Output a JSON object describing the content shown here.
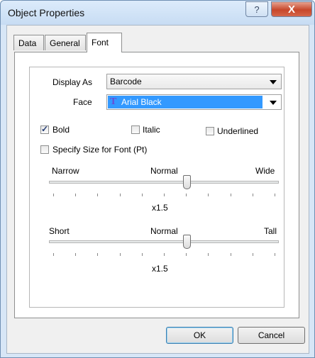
{
  "window": {
    "title": "Object Properties",
    "help_glyph": "?",
    "close_glyph": "X"
  },
  "tabs": [
    {
      "label": "Data"
    },
    {
      "label": "General"
    },
    {
      "label": "Font"
    }
  ],
  "form": {
    "display_as_label": "Display As",
    "display_as_value": "Barcode",
    "face_label": "Face",
    "face_value": "Arial Black",
    "face_icon_glyph": "T",
    "bold_label": "Bold",
    "bold_checked": true,
    "italic_label": "Italic",
    "italic_checked": false,
    "underlined_label": "Underlined",
    "underlined_checked": false,
    "specify_size_label": "Specify Size for Font (Pt)",
    "specify_size_checked": false
  },
  "width_slider": {
    "left_label": "Narrow",
    "mid_label": "Normal",
    "right_label": "Wide",
    "value_text": "x1.5",
    "value_fraction": 0.6
  },
  "height_slider": {
    "left_label": "Short",
    "mid_label": "Normal",
    "right_label": "Tall",
    "value_text": "x1.5",
    "value_fraction": 0.6
  },
  "buttons": {
    "ok": "OK",
    "cancel": "Cancel"
  },
  "colors": {
    "selection": "#3399ff",
    "close": "#c7472b"
  }
}
